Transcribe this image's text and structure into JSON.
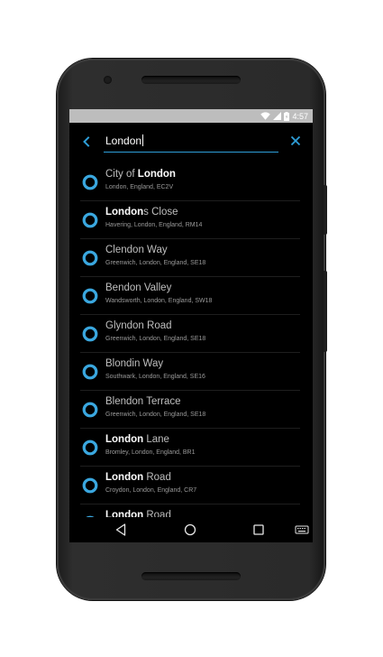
{
  "status_bar": {
    "time": "4:57",
    "icons": [
      "wifi-icon",
      "signal-icon",
      "battery-icon"
    ]
  },
  "search": {
    "query": "London",
    "back_icon": "back-chevron-icon",
    "clear_icon": "close-icon",
    "accent_color": "#2e9fd9"
  },
  "results": [
    {
      "prefix": "City of ",
      "match": "London",
      "suffix": "",
      "address": "London, England, EC2V"
    },
    {
      "prefix": "",
      "match": "London",
      "suffix": "s Close",
      "address": "Havering, London, England, RM14"
    },
    {
      "prefix": "Clendon Way",
      "match": "",
      "suffix": "",
      "address": "Greenwich, London, England, SE18"
    },
    {
      "prefix": "Bendon Valley",
      "match": "",
      "suffix": "",
      "address": "Wandsworth, London, England, SW18"
    },
    {
      "prefix": "Glyndon Road",
      "match": "",
      "suffix": "",
      "address": "Greenwich, London, England, SE18"
    },
    {
      "prefix": "Blondin Way",
      "match": "",
      "suffix": "",
      "address": "Southwark, London, England, SE16"
    },
    {
      "prefix": "Blendon Terrace",
      "match": "",
      "suffix": "",
      "address": "Greenwich, London, England, SE18"
    },
    {
      "prefix": "",
      "match": "London",
      "suffix": " Lane",
      "address": "Bromley, London, England, BR1"
    },
    {
      "prefix": "",
      "match": "London",
      "suffix": " Road",
      "address": "Croydon, London, England, CR7"
    },
    {
      "prefix": "",
      "match": "London",
      "suffix": " Road",
      "address": ""
    }
  ],
  "nav_bar": {
    "buttons": [
      "back-icon",
      "home-icon",
      "recents-icon",
      "keyboard-icon"
    ]
  }
}
